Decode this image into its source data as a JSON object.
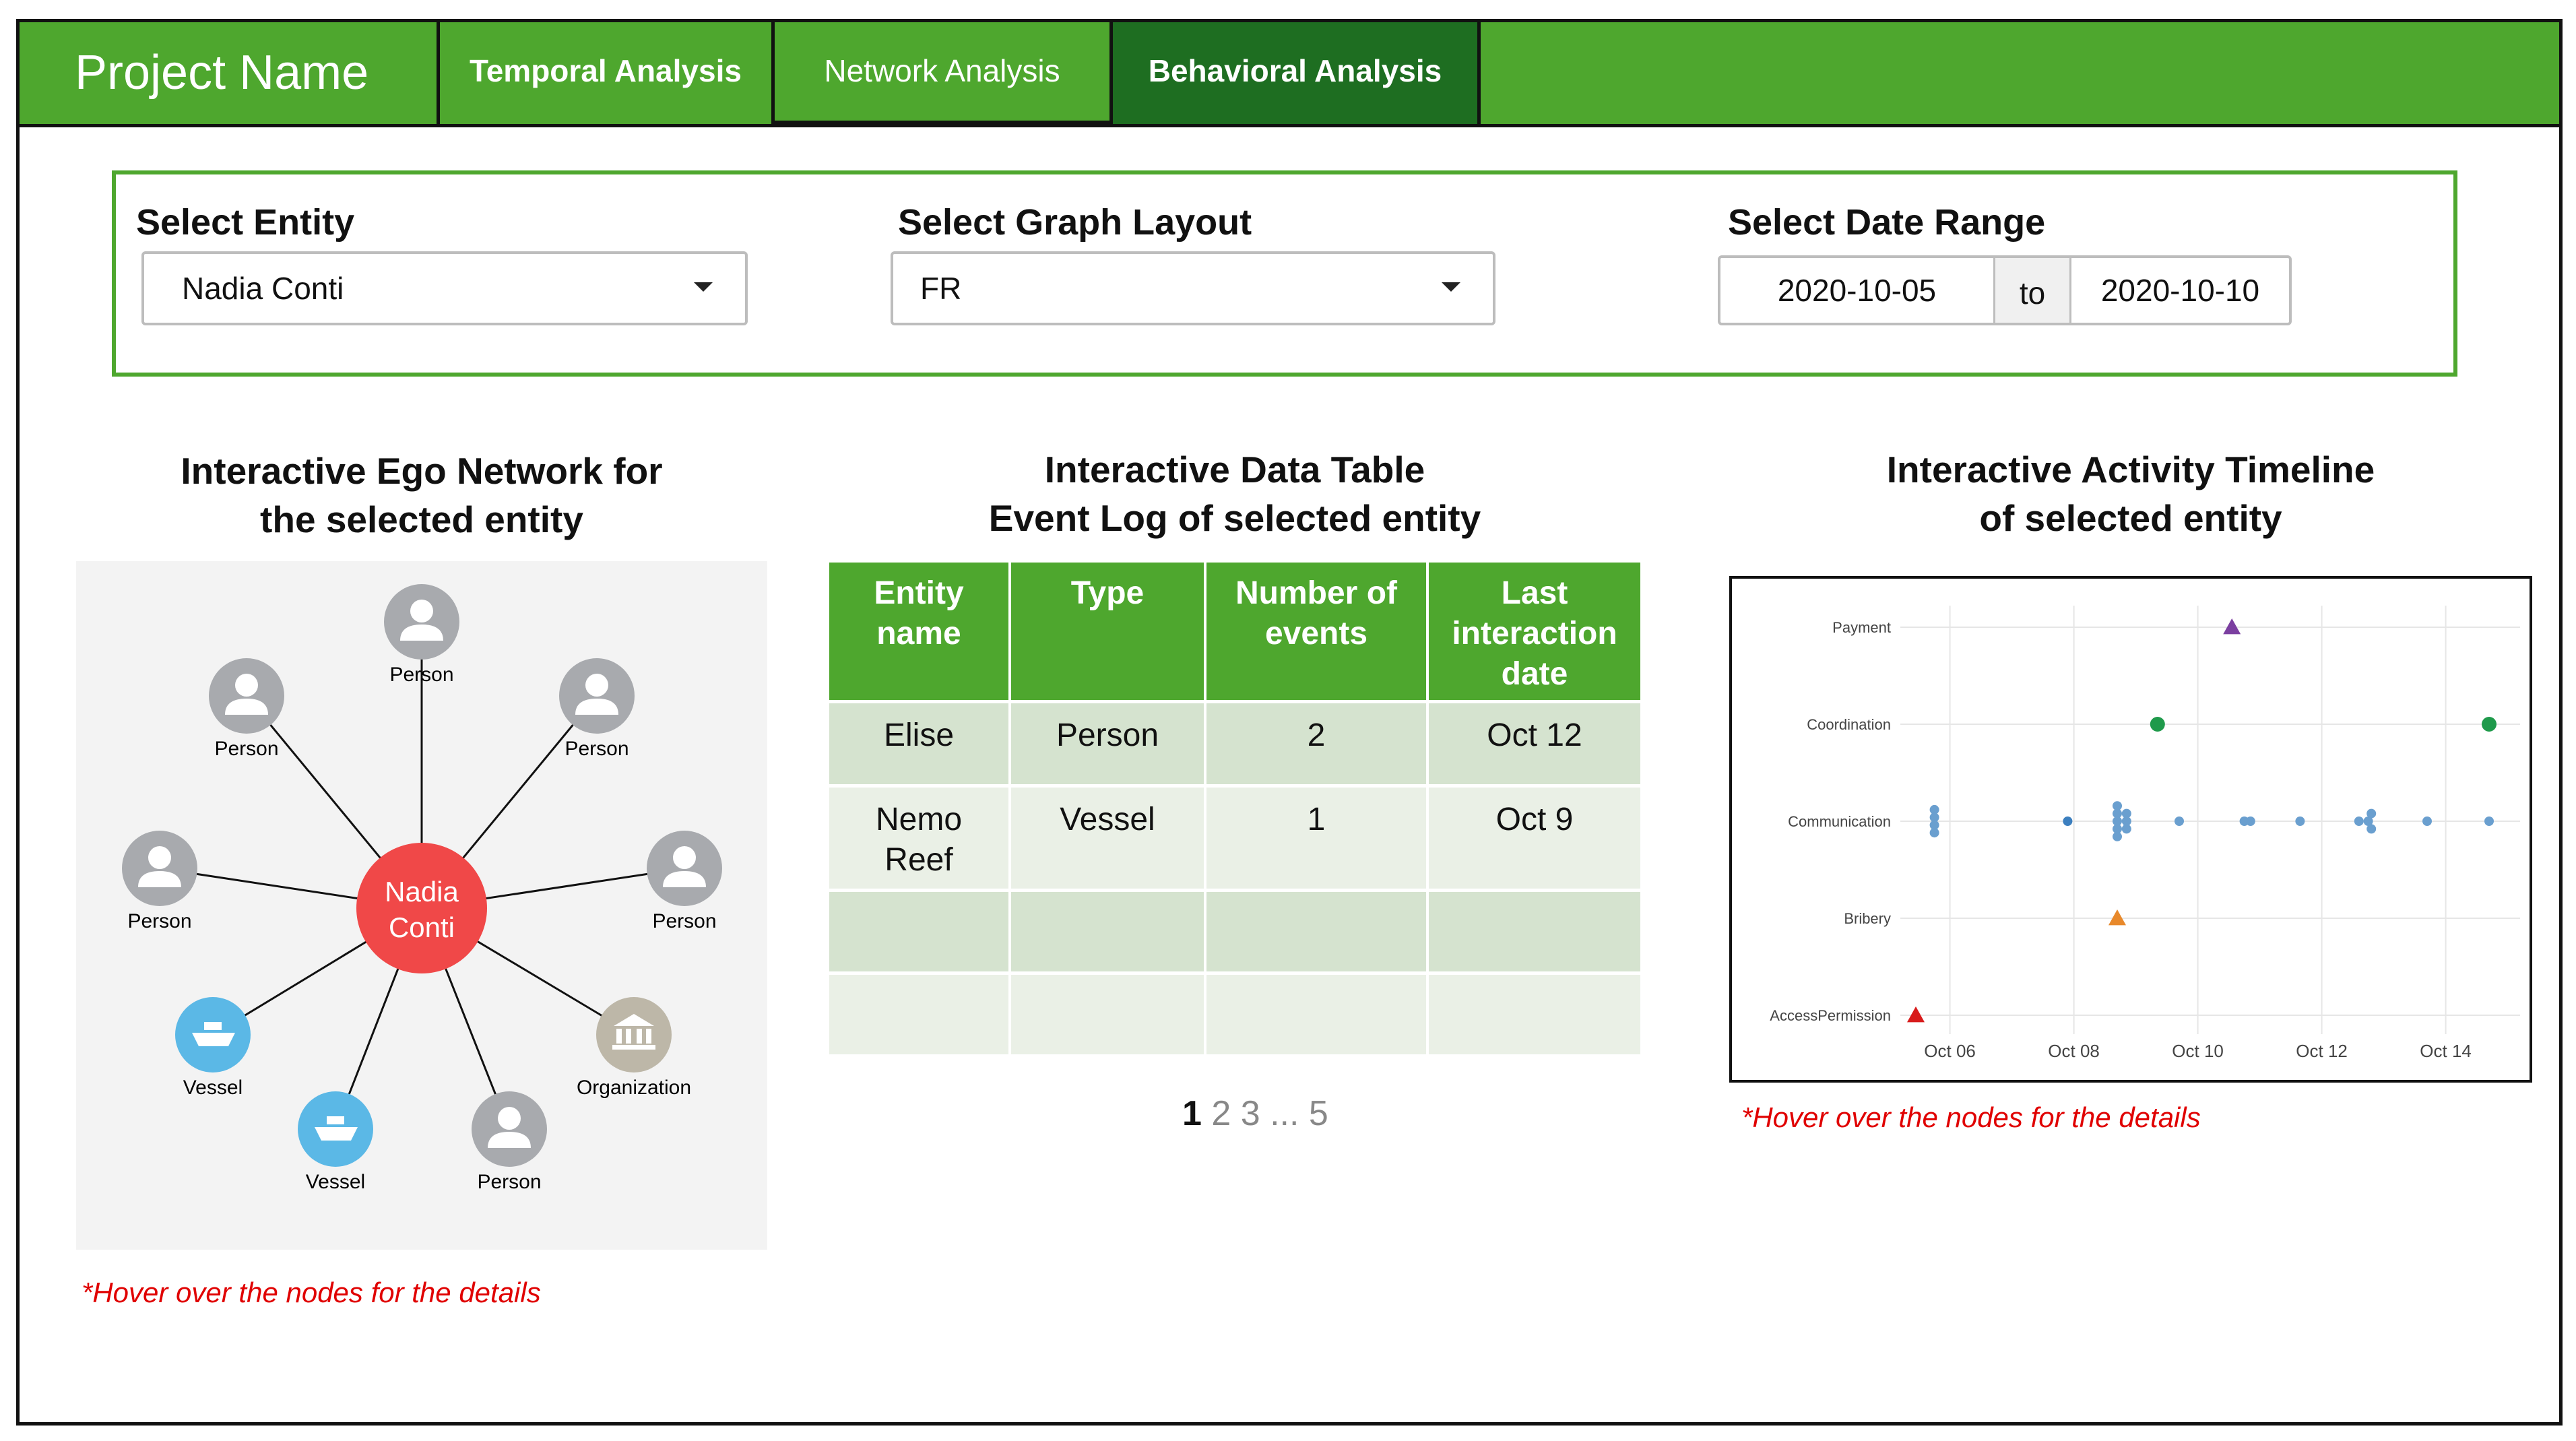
{
  "header": {
    "project_name": "Project Name",
    "tabs": [
      {
        "label": "Temporal Analysis"
      },
      {
        "label": "Network Analysis"
      },
      {
        "label": "Behavioral Analysis"
      }
    ],
    "active_tab": "Behavioral Analysis"
  },
  "controls": {
    "entity": {
      "label": "Select Entity",
      "value": "Nadia Conti"
    },
    "layout": {
      "label": "Select Graph Layout",
      "value": "FR"
    },
    "date_range": {
      "label": "Select Date Range",
      "start": "2020-10-05",
      "separator": "to",
      "end": "2020-10-10"
    }
  },
  "ego_network": {
    "title_line1": "Interactive Ego Network for",
    "title_line2": "the selected entity",
    "center": {
      "label_line1": "Nadia",
      "label_line2": "Conti"
    },
    "nodes": [
      {
        "type": "person",
        "label": "Person"
      },
      {
        "type": "person",
        "label": "Person"
      },
      {
        "type": "person",
        "label": "Person"
      },
      {
        "type": "person",
        "label": "Person"
      },
      {
        "type": "person",
        "label": "Person"
      },
      {
        "type": "vessel",
        "label": "Vessel"
      },
      {
        "type": "vessel",
        "label": "Vessel"
      },
      {
        "type": "person",
        "label": "Person"
      },
      {
        "type": "organization",
        "label": "Organization"
      }
    ],
    "hint": "*Hover over the nodes for the details",
    "colors": {
      "center": "#f04848",
      "person": "#a8aaae",
      "vessel": "#5bb8e6",
      "organization": "#bdb7a8"
    }
  },
  "data_table": {
    "title_line1": "Interactive Data Table",
    "title_line2": "Event Log of selected entity",
    "columns": [
      [
        "Entity",
        "name"
      ],
      [
        "Type"
      ],
      [
        "Number of",
        "events"
      ],
      [
        "Last",
        "interaction",
        "date"
      ]
    ],
    "rows": [
      {
        "name": [
          "Elise"
        ],
        "type": "Person",
        "events": "2",
        "date": "Oct 12"
      },
      {
        "name": [
          "Nemo",
          "Reef"
        ],
        "type": "Vessel",
        "events": "1",
        "date": "Oct 9"
      },
      {
        "name": [
          ""
        ],
        "type": "",
        "events": "",
        "date": ""
      },
      {
        "name": [
          ""
        ],
        "type": "",
        "events": "",
        "date": ""
      }
    ],
    "pagination": {
      "current": "1",
      "others": " 2 3 ... 5"
    }
  },
  "timeline": {
    "title_line1": "Interactive Activity Timeline",
    "title_line2": "of selected entity",
    "hint": "*Hover over the nodes for the details",
    "chart_data": {
      "type": "scatter",
      "title": "",
      "xlabel": "",
      "ylabel": "",
      "categories": [
        "Payment",
        "Coordination",
        "Communication",
        "Bribery",
        "AccessPermission"
      ],
      "x_ticks": [
        "Oct 06",
        "Oct 08",
        "Oct 10",
        "Oct 12",
        "Oct 14"
      ],
      "xlim": [
        5.2,
        15.2
      ],
      "grid": true,
      "points": [
        {
          "x": 10.55,
          "cat": "Payment",
          "shape": "triangle",
          "color": "#7b3fa0"
        },
        {
          "x": 9.35,
          "cat": "Coordination",
          "shape": "circle-lg",
          "color": "#1f9a4b"
        },
        {
          "x": 14.7,
          "cat": "Coordination",
          "shape": "circle-lg",
          "color": "#1f9a4b"
        },
        {
          "x": 5.75,
          "cat": "Communication",
          "dy": -0.3,
          "shape": "circle",
          "color": "#6a9fcf"
        },
        {
          "x": 5.75,
          "cat": "Communication",
          "dy": -0.1,
          "shape": "circle",
          "color": "#6a9fcf"
        },
        {
          "x": 5.75,
          "cat": "Communication",
          "dy": 0.1,
          "shape": "circle",
          "color": "#6a9fcf"
        },
        {
          "x": 5.75,
          "cat": "Communication",
          "dy": 0.3,
          "shape": "circle",
          "color": "#6a9fcf"
        },
        {
          "x": 7.9,
          "cat": "Communication",
          "dy": 0,
          "shape": "circle",
          "color": "#3c7fbf"
        },
        {
          "x": 8.7,
          "cat": "Communication",
          "dy": -0.4,
          "shape": "circle",
          "color": "#6a9fcf"
        },
        {
          "x": 8.7,
          "cat": "Communication",
          "dy": -0.2,
          "shape": "circle",
          "color": "#6a9fcf"
        },
        {
          "x": 8.7,
          "cat": "Communication",
          "dy": 0,
          "shape": "circle",
          "color": "#6a9fcf"
        },
        {
          "x": 8.7,
          "cat": "Communication",
          "dy": 0.2,
          "shape": "circle",
          "color": "#6a9fcf"
        },
        {
          "x": 8.7,
          "cat": "Communication",
          "dy": 0.4,
          "shape": "circle",
          "color": "#6a9fcf"
        },
        {
          "x": 8.85,
          "cat": "Communication",
          "dy": -0.2,
          "shape": "circle",
          "color": "#6a9fcf"
        },
        {
          "x": 8.85,
          "cat": "Communication",
          "dy": 0,
          "shape": "circle",
          "color": "#6a9fcf"
        },
        {
          "x": 8.85,
          "cat": "Communication",
          "dy": 0.2,
          "shape": "circle",
          "color": "#6a9fcf"
        },
        {
          "x": 9.7,
          "cat": "Communication",
          "dy": 0,
          "shape": "circle",
          "color": "#6a9fcf"
        },
        {
          "x": 10.75,
          "cat": "Communication",
          "dy": 0,
          "shape": "circle",
          "color": "#6a9fcf"
        },
        {
          "x": 10.85,
          "cat": "Communication",
          "dy": 0,
          "shape": "circle",
          "color": "#6a9fcf"
        },
        {
          "x": 11.65,
          "cat": "Communication",
          "dy": 0,
          "shape": "circle",
          "color": "#6a9fcf"
        },
        {
          "x": 12.6,
          "cat": "Communication",
          "dy": 0,
          "shape": "circle",
          "color": "#6a9fcf"
        },
        {
          "x": 12.75,
          "cat": "Communication",
          "dy": 0,
          "shape": "circle",
          "color": "#6a9fcf"
        },
        {
          "x": 12.8,
          "cat": "Communication",
          "dy": -0.2,
          "shape": "circle",
          "color": "#6a9fcf"
        },
        {
          "x": 12.8,
          "cat": "Communication",
          "dy": 0.2,
          "shape": "circle",
          "color": "#6a9fcf"
        },
        {
          "x": 13.7,
          "cat": "Communication",
          "dy": 0,
          "shape": "circle",
          "color": "#6a9fcf"
        },
        {
          "x": 14.7,
          "cat": "Communication",
          "dy": 0,
          "shape": "circle",
          "color": "#6a9fcf"
        },
        {
          "x": 8.7,
          "cat": "Bribery",
          "shape": "triangle",
          "color": "#e8892b"
        },
        {
          "x": 5.45,
          "cat": "AccessPermission",
          "shape": "triangle",
          "color": "#d81b1b"
        }
      ]
    }
  }
}
